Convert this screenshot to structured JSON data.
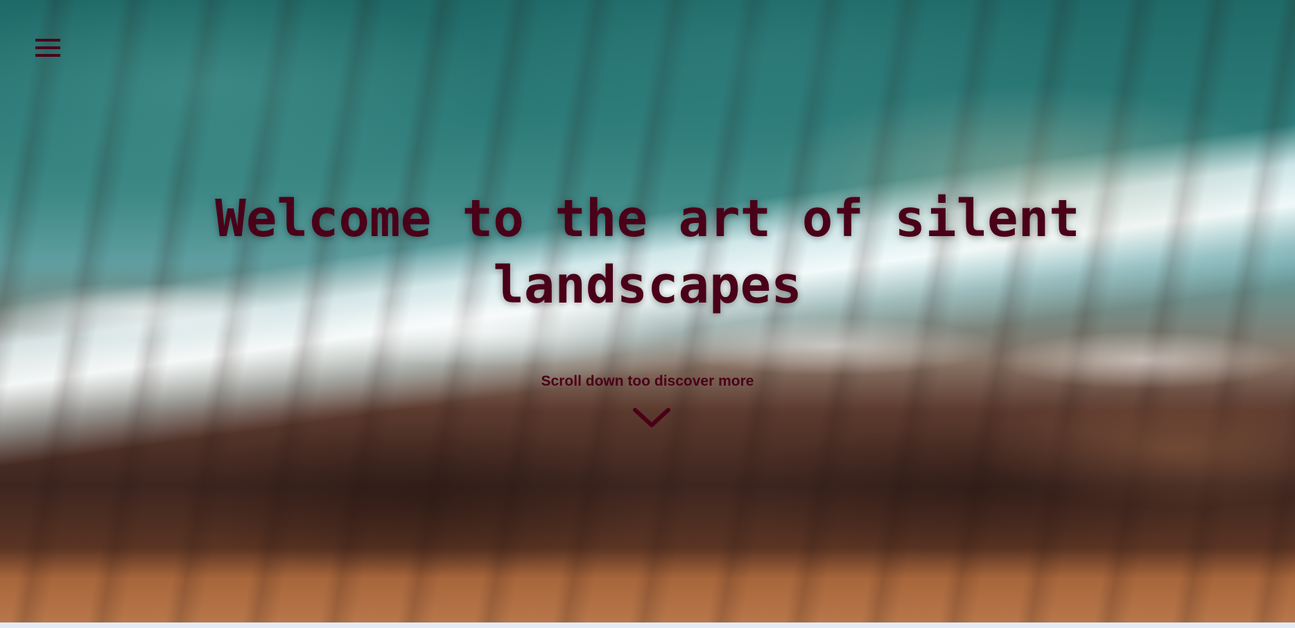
{
  "header": {
    "menu_icon": "hamburger-menu-icon"
  },
  "hero": {
    "title": "Welcome to the art of silent landscapes",
    "scroll_hint": "Scroll down too discover more",
    "scroll_icon": "chevron-down-icon"
  },
  "colors": {
    "accent_text": "#4a0018",
    "page_background": "#e6edf6"
  }
}
